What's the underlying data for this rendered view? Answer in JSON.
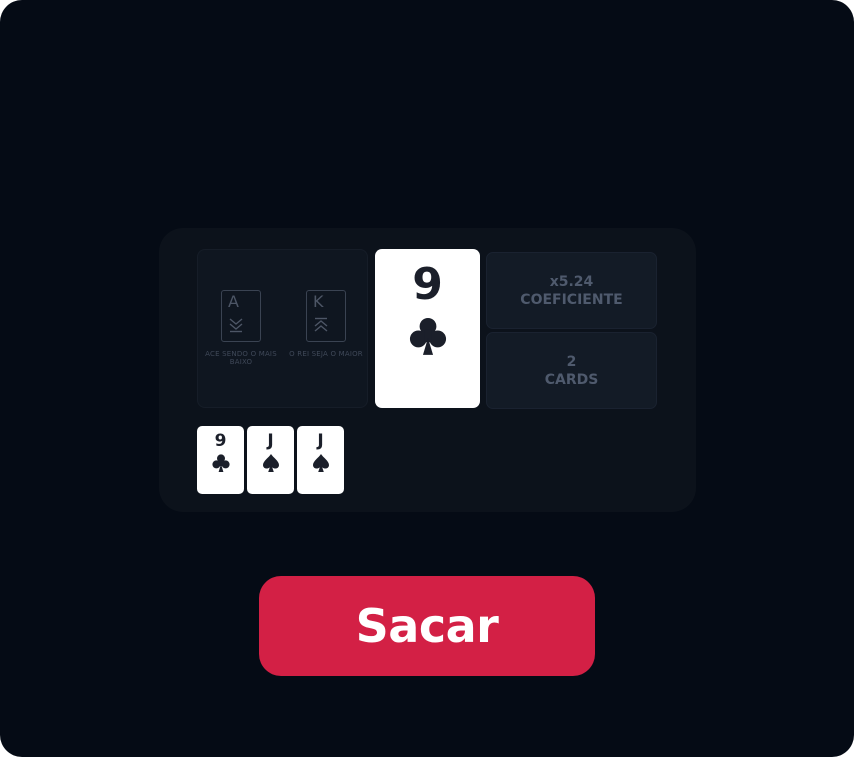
{
  "colors": {
    "background": "#050b15",
    "panel": "#0c121b",
    "card": "#ffffff",
    "card_ink": "#1b1f2a",
    "accent": "#d32045",
    "muted_text": "#4f5a6d"
  },
  "hints": {
    "ace": {
      "letter": "A",
      "icon": "double-chevron-down-icon",
      "caption": "ACE SENDO O MAIS BAIXO"
    },
    "king": {
      "letter": "K",
      "icon": "double-chevron-up-icon",
      "caption": "O REI SEJA O MAIOR"
    }
  },
  "current_card": {
    "rank": "9",
    "suit": "clubs",
    "icon": "club-icon"
  },
  "coefficient": {
    "value": "x5.24",
    "label": "COEFICIENTE"
  },
  "cards_count": {
    "value": "2",
    "label": "CARDS"
  },
  "history": [
    {
      "rank": "9",
      "suit": "clubs",
      "icon": "club-icon"
    },
    {
      "rank": "J",
      "suit": "spades",
      "icon": "spade-icon"
    },
    {
      "rank": "J",
      "suit": "spades",
      "icon": "spade-icon"
    }
  ],
  "action": {
    "draw_label": "Sacar"
  }
}
